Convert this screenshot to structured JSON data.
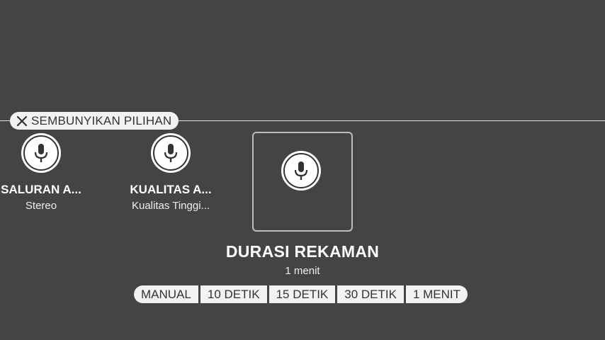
{
  "hide_options": {
    "label": "SEMBUNYIKAN PILIHAN",
    "icon": "close-icon"
  },
  "options": [
    {
      "title": "SALURAN A...",
      "value": "Stereo",
      "icon": "microphone-icon"
    },
    {
      "title": "KUALITAS A...",
      "value": "Kualitas Tinggi...",
      "icon": "microphone-icon"
    }
  ],
  "selected": {
    "icon": "microphone-icon",
    "title": "DURASI REKAMAN",
    "value": "1 menit"
  },
  "duration_choices": [
    "MANUAL",
    "10 DETIK",
    "15 DETIK",
    "30 DETIK",
    "1 MENIT"
  ],
  "colors": {
    "background": "#444444",
    "chip": "#f2f2f2",
    "chip_text": "#333333"
  }
}
